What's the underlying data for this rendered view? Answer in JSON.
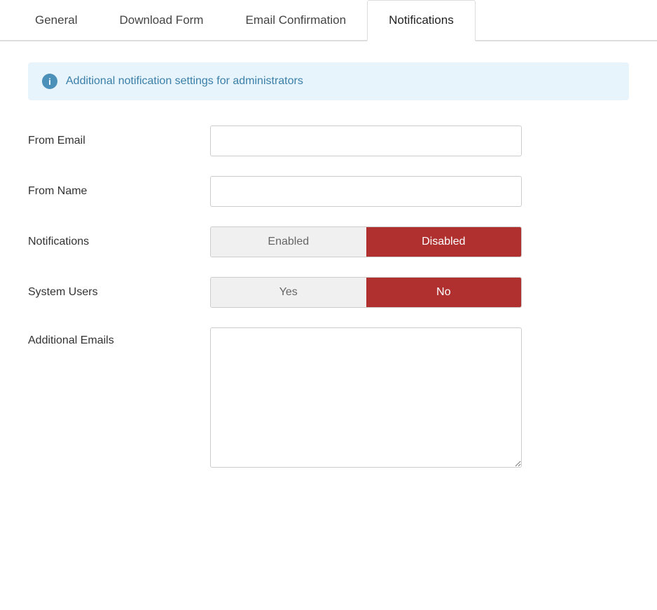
{
  "tabs": {
    "items": [
      {
        "label": "General",
        "active": false
      },
      {
        "label": "Download Form",
        "active": false
      },
      {
        "label": "Email Confirmation",
        "active": false
      },
      {
        "label": "Notifications",
        "active": true
      }
    ]
  },
  "infoBanner": {
    "text": "Additional notification settings for administrators",
    "icon": "i"
  },
  "form": {
    "fields": [
      {
        "label": "From Email",
        "type": "input",
        "value": "",
        "placeholder": ""
      },
      {
        "label": "From Name",
        "type": "input",
        "value": "",
        "placeholder": ""
      },
      {
        "label": "Notifications",
        "type": "toggle",
        "options": [
          "Enabled",
          "Disabled"
        ],
        "selected": "Disabled"
      },
      {
        "label": "System Users",
        "type": "toggle",
        "options": [
          "Yes",
          "No"
        ],
        "selected": "No"
      },
      {
        "label": "Additional Emails",
        "type": "textarea",
        "value": "",
        "placeholder": ""
      }
    ]
  }
}
